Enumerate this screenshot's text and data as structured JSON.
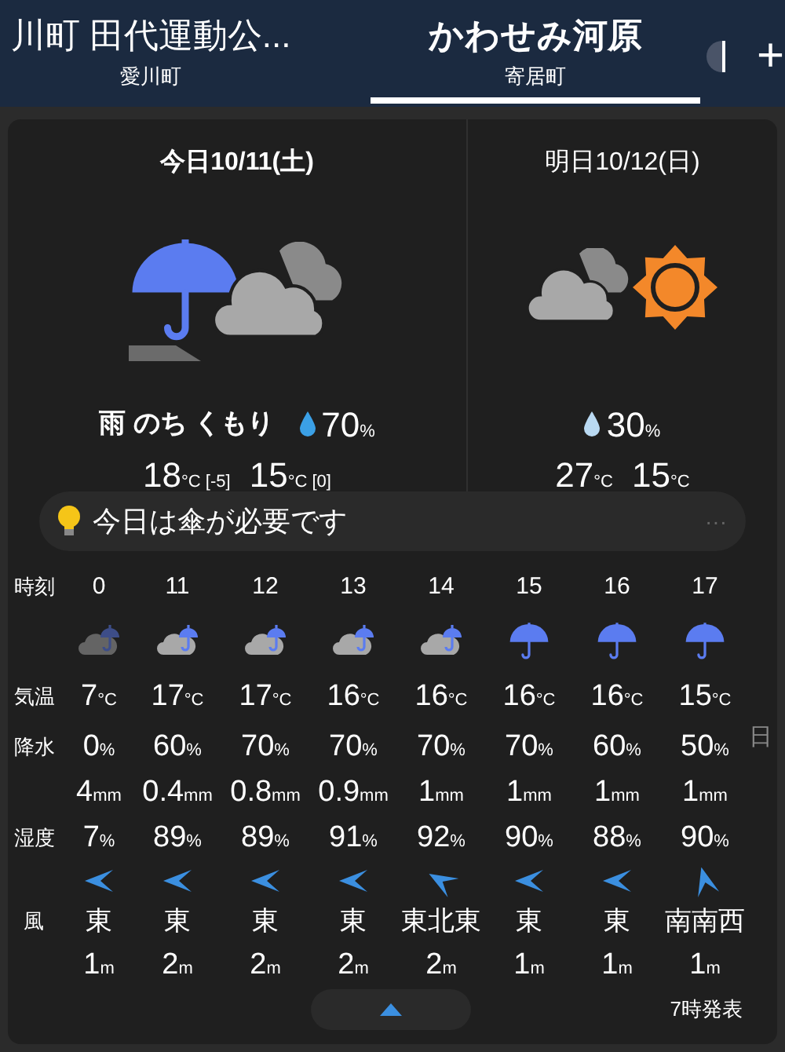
{
  "tabs": [
    {
      "title": "川町 田代運動公...",
      "subtitle": "愛川町",
      "selected": false
    },
    {
      "title": "かわせみ河原",
      "subtitle": "寄居町",
      "selected": true
    }
  ],
  "add_button": "+",
  "days": [
    {
      "date": "今日10/11(土)",
      "kind": "rain-then-cloudy",
      "weather": "雨 のち くもり",
      "precip": {
        "value": "70",
        "unit": "%"
      },
      "color": "#3ba0e6",
      "high": {
        "value": "18",
        "unit": "°C [-5]"
      },
      "low": {
        "value": "15",
        "unit": "°C [0]"
      }
    },
    {
      "date": "明日10/12(日)",
      "kind": "cloudy-sunny",
      "precip": {
        "value": "30",
        "unit": "%"
      },
      "color": "#b9d9f2",
      "high": {
        "value": "27",
        "unit": "°C"
      },
      "low": {
        "value": "15",
        "unit": "°C"
      }
    }
  ],
  "tip": {
    "text": "今日は傘が必要です",
    "more": "···"
  },
  "hourly": {
    "labels": {
      "time": "時刻",
      "temp": "気温",
      "precip": "降水",
      "humidity": "湿度",
      "wind": "風"
    },
    "hours": [
      {
        "time": "0",
        "kind": "cloud-rain",
        "temp": {
          "value": "7",
          "unit": "°C"
        },
        "precip": {
          "value": "0",
          "unit": "%"
        },
        "amount": {
          "value": "4",
          "unit": "mm"
        },
        "humidity": {
          "value": "7",
          "unit": "%"
        },
        "wind": {
          "kind": "left",
          "dir": "東",
          "speed": {
            "value": "1",
            "unit": "m"
          }
        }
      },
      {
        "time": "11",
        "kind": "cloud-rain",
        "temp": {
          "value": "17",
          "unit": "°C"
        },
        "precip": {
          "value": "60",
          "unit": "%"
        },
        "amount": {
          "value": "0.4",
          "unit": "mm"
        },
        "humidity": {
          "value": "89",
          "unit": "%"
        },
        "wind": {
          "kind": "left",
          "dir": "東",
          "speed": {
            "value": "2",
            "unit": "m"
          }
        }
      },
      {
        "time": "12",
        "kind": "cloud-rain",
        "temp": {
          "value": "17",
          "unit": "°C"
        },
        "precip": {
          "value": "70",
          "unit": "%"
        },
        "amount": {
          "value": "0.8",
          "unit": "mm"
        },
        "humidity": {
          "value": "89",
          "unit": "%"
        },
        "wind": {
          "kind": "left",
          "dir": "東",
          "speed": {
            "value": "2",
            "unit": "m"
          }
        }
      },
      {
        "time": "13",
        "kind": "cloud-rain",
        "temp": {
          "value": "16",
          "unit": "°C"
        },
        "precip": {
          "value": "70",
          "unit": "%"
        },
        "amount": {
          "value": "0.9",
          "unit": "mm"
        },
        "humidity": {
          "value": "91",
          "unit": "%"
        },
        "wind": {
          "kind": "left",
          "dir": "東",
          "speed": {
            "value": "2",
            "unit": "m"
          }
        }
      },
      {
        "time": "14",
        "kind": "cloud-rain",
        "temp": {
          "value": "16",
          "unit": "°C"
        },
        "precip": {
          "value": "70",
          "unit": "%"
        },
        "amount": {
          "value": "1",
          "unit": "mm"
        },
        "humidity": {
          "value": "92",
          "unit": "%"
        },
        "wind": {
          "kind": "left-up",
          "dir": "東北東",
          "speed": {
            "value": "2",
            "unit": "m"
          }
        }
      },
      {
        "time": "15",
        "kind": "rain",
        "temp": {
          "value": "16",
          "unit": "°C"
        },
        "precip": {
          "value": "70",
          "unit": "%"
        },
        "amount": {
          "value": "1",
          "unit": "mm"
        },
        "humidity": {
          "value": "90",
          "unit": "%"
        },
        "wind": {
          "kind": "left",
          "dir": "東",
          "speed": {
            "value": "1",
            "unit": "m"
          }
        }
      },
      {
        "time": "16",
        "kind": "rain",
        "temp": {
          "value": "16",
          "unit": "°C"
        },
        "precip": {
          "value": "60",
          "unit": "%"
        },
        "amount": {
          "value": "1",
          "unit": "mm"
        },
        "humidity": {
          "value": "88",
          "unit": "%"
        },
        "wind": {
          "kind": "left",
          "dir": "東",
          "speed": {
            "value": "1",
            "unit": "m"
          }
        }
      },
      {
        "time": "17",
        "kind": "rain",
        "temp": {
          "value": "15",
          "unit": "°C"
        },
        "precip": {
          "value": "50",
          "unit": "%"
        },
        "amount": {
          "value": "1",
          "unit": "mm"
        },
        "humidity": {
          "value": "90",
          "unit": "%"
        },
        "wind": {
          "kind": "up",
          "dir": "南南西",
          "speed": {
            "value": "1",
            "unit": "m"
          }
        }
      }
    ],
    "edge_marker": "日"
  },
  "issued": "7時発表"
}
